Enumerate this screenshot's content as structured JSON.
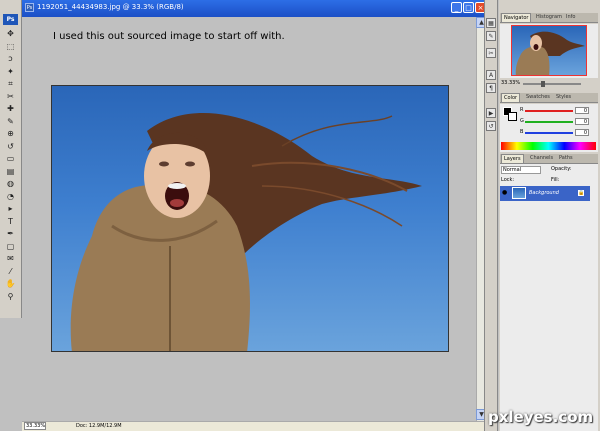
{
  "window": {
    "title": "1192051_44434983.jpg @ 33.3% (RGB/8)",
    "minimize": "_",
    "maximize": "□",
    "close": "×"
  },
  "toolbox": {
    "logo": "Ps",
    "tools": [
      "move-tool-icon",
      "marquee-tool-icon",
      "lasso-tool-icon",
      "magic-wand-tool-icon",
      "crop-tool-icon",
      "slice-tool-icon",
      "healing-brush-tool-icon",
      "brush-tool-icon",
      "clone-stamp-tool-icon",
      "history-brush-tool-icon",
      "eraser-tool-icon",
      "gradient-tool-icon",
      "blur-tool-icon",
      "dodge-tool-icon",
      "path-selection-tool-icon",
      "type-tool-icon",
      "pen-tool-icon",
      "shape-tool-icon",
      "notes-tool-icon",
      "eyedropper-tool-icon",
      "hand-tool-icon",
      "zoom-tool-icon"
    ],
    "glyphs": [
      "✥",
      "⬚",
      "ↄ",
      "✦",
      "⌗",
      "✂",
      "✚",
      "✎",
      "⊕",
      "↺",
      "▭",
      "▤",
      "◍",
      "◔",
      "▸",
      "T",
      "✒",
      "▢",
      "✉",
      "⁄",
      "✋",
      "⚲"
    ]
  },
  "document": {
    "caption": "I used this out sourced image to start off with.",
    "zoom": "33.33%",
    "doc_size": "Doc: 12.9M/12.9M"
  },
  "palettes": {
    "navigator_tabs": [
      "Navigator",
      "Histogram",
      "Info"
    ],
    "navigator_zoom": "33.33%",
    "color_tabs": [
      "Color",
      "Swatches",
      "Styles"
    ],
    "color_channels": [
      {
        "label": "R",
        "value": "0",
        "color": "#e02020"
      },
      {
        "label": "G",
        "value": "0",
        "color": "#20b020"
      },
      {
        "label": "B",
        "value": "0",
        "color": "#2040e0"
      }
    ],
    "layers_tabs": [
      "Layers",
      "Channels",
      "Paths"
    ],
    "layers_mode": "Normal",
    "layers_opacity": "Opacity:",
    "layers_lock": "Lock:",
    "layers_fill": "Fill:",
    "layer_name": "Background"
  },
  "watermark": "pxleyes.com",
  "colors": {
    "accent": "#1c4fc6",
    "sky": "#3e7fcf",
    "layer_selected": "#3a64c7"
  }
}
